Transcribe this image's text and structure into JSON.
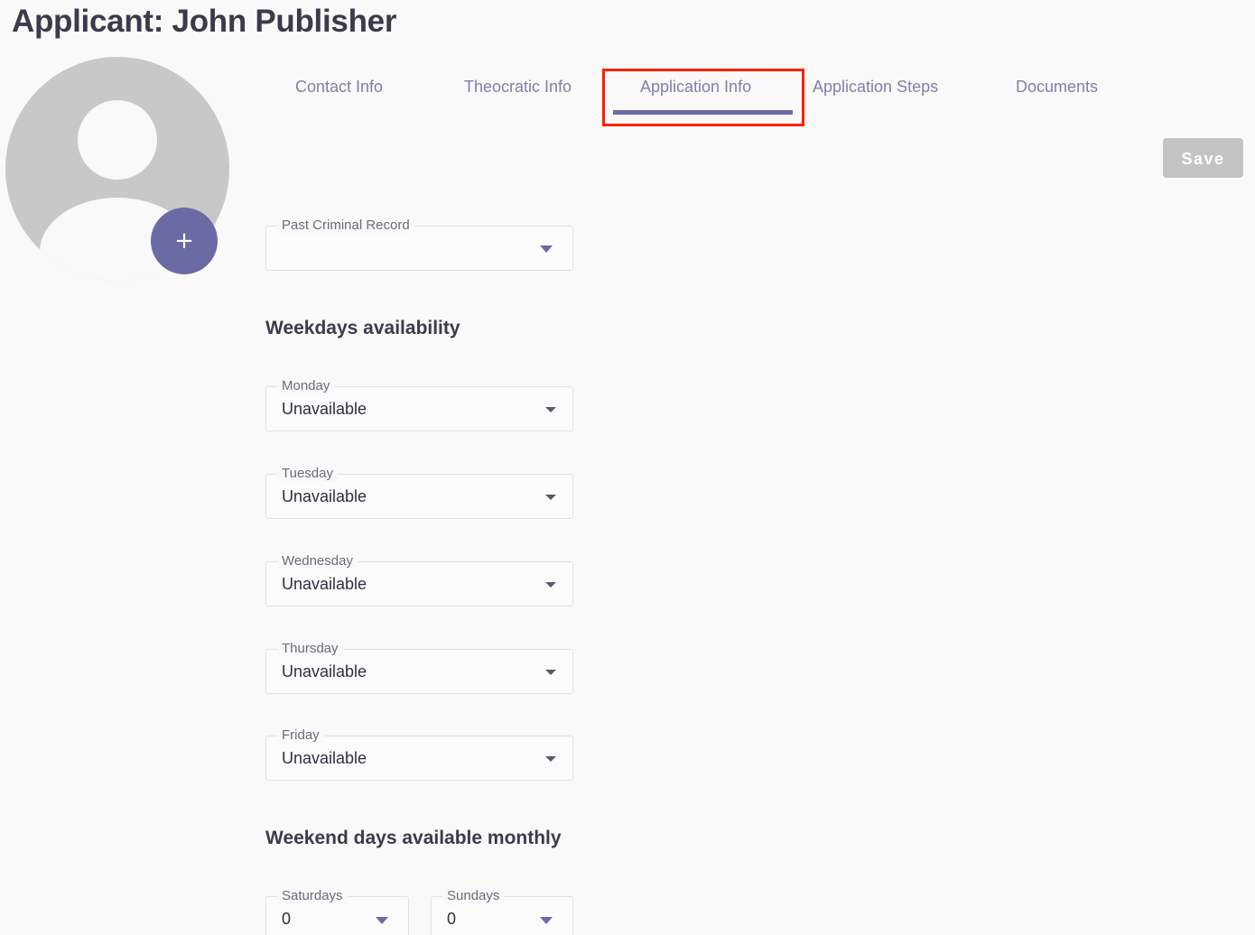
{
  "header": {
    "title": "Applicant: John Publisher"
  },
  "avatar": {
    "icon": "user-placeholder-icon",
    "add_label": "+"
  },
  "tabs": [
    {
      "label": "Contact Info",
      "active": false
    },
    {
      "label": "Theocratic Info",
      "active": false
    },
    {
      "label": "Application Info",
      "active": true
    },
    {
      "label": "Application Steps",
      "active": false
    },
    {
      "label": "Documents",
      "active": false
    }
  ],
  "toolbar": {
    "save_label": "Save"
  },
  "form": {
    "criminal_record": {
      "label": "Past Criminal Record",
      "value": ""
    },
    "weekdays_heading": "Weekdays availability",
    "weekdays": [
      {
        "label": "Monday",
        "value": "Unavailable"
      },
      {
        "label": "Tuesday",
        "value": "Unavailable"
      },
      {
        "label": "Wednesday",
        "value": "Unavailable"
      },
      {
        "label": "Thursday",
        "value": "Unavailable"
      },
      {
        "label": "Friday",
        "value": "Unavailable"
      }
    ],
    "weekend_heading": "Weekend days available monthly",
    "weekend": [
      {
        "label": "Saturdays",
        "value": "0"
      },
      {
        "label": "Sundays",
        "value": "0"
      }
    ]
  },
  "colors": {
    "accent": "#6a6ba5",
    "highlight": "#ff1f00",
    "save_disabled": "#c4c4c4"
  }
}
